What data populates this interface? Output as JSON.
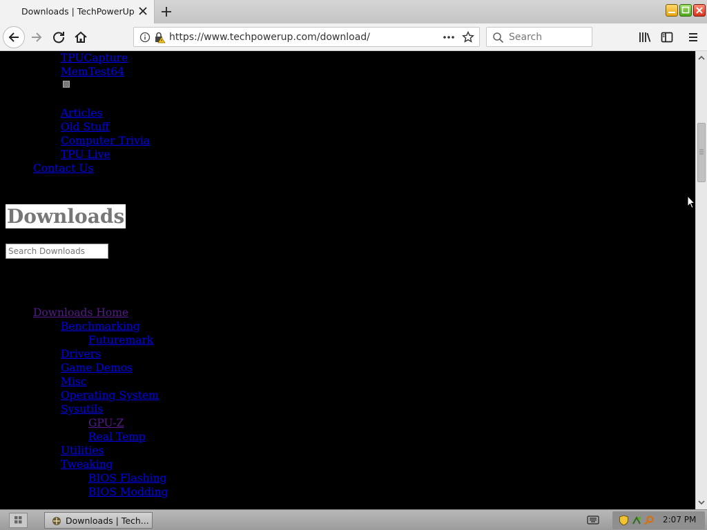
{
  "browser": {
    "tab_title": "Downloads | TechPowerUp",
    "url": "https://www.techpowerup.com/download/",
    "search_placeholder": "Search",
    "icons": [
      "back-icon",
      "forward-icon",
      "reload-icon",
      "home-icon",
      "info-icon",
      "lock-warning-icon",
      "page-actions-icon",
      "bookmark-star-icon",
      "search-icon",
      "library-icon",
      "sidebar-icon",
      "menu-icon"
    ]
  },
  "page": {
    "nav_top": {
      "tpucapture": "TPUCapture",
      "memtest64": "MemTest64",
      "articles": "Articles",
      "old_stuff": "Old Stuff",
      "computer_trivia": "Computer Trivia",
      "tpu_live": "TPU Live",
      "contact_us": "Contact Us"
    },
    "heading": "Downloads",
    "search_placeholder": "Search Downloads",
    "downloads_nav": {
      "home": "Downloads Home",
      "benchmarking": "Benchmarking",
      "futuremark": "Futuremark",
      "drivers": "Drivers",
      "game_demos": "Game Demos",
      "misc": "Misc",
      "operating_system": "Operating System",
      "sysutils": "Sysutils",
      "gpu_z": "GPU-Z",
      "real_temp": "Real Temp",
      "utilities": "Utilities",
      "tweaking": "Tweaking",
      "bios_flashing": "BIOS Flashing",
      "bios_modding": "BIOS Modding"
    }
  },
  "taskbar": {
    "task_label": "Downloads | Tech...",
    "clock": "2:07 PM"
  },
  "colors": {
    "link": "#0000ee",
    "visited_link": "#551a8b",
    "page_background": "#000000",
    "heading_text": "#777777"
  }
}
